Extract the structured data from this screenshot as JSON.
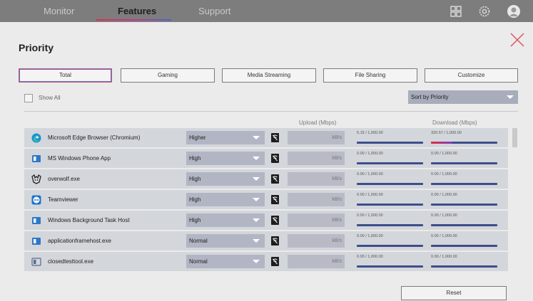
{
  "nav": {
    "items": [
      {
        "label": "Monitor",
        "active": false
      },
      {
        "label": "Features",
        "active": true
      },
      {
        "label": "Support",
        "active": false
      }
    ],
    "icons": [
      "grid-icon",
      "gear-icon",
      "profile-icon"
    ]
  },
  "page": {
    "title": "Priority",
    "tabs": [
      {
        "label": "Total",
        "active": true
      },
      {
        "label": "Gaming",
        "active": false
      },
      {
        "label": "Media Streaming",
        "active": false
      },
      {
        "label": "File Sharing",
        "active": false
      },
      {
        "label": "Customize",
        "active": false
      }
    ],
    "show_all_label": "Show All",
    "show_all_checked": false,
    "sort_selected": "Sort by Priority",
    "upload_header": "Upload (Mbps)",
    "download_header": "Download (Mbps)",
    "reset_label": "Reset"
  },
  "apps": [
    {
      "name": "Microsoft Edge Browser (Chromium)",
      "icon": "edge-icon",
      "priority": "Higher",
      "unit": "kB/s",
      "upload": "5.15 / 1,000.00",
      "download": "320.57 / 1,000.00",
      "upload_fraction": 0.00515,
      "download_fraction": 0.32057
    },
    {
      "name": "MS Windows Phone App",
      "icon": "window-app-icon",
      "priority": "High",
      "unit": "kB/s",
      "upload": "0.00 / 1,000.00",
      "download": "0.00 / 1,000.00",
      "upload_fraction": 0,
      "download_fraction": 0
    },
    {
      "name": "overwolf.exe",
      "icon": "overwolf-icon",
      "priority": "High",
      "unit": "kB/s",
      "upload": "0.00 / 1,000.00",
      "download": "0.00 / 1,000.00",
      "upload_fraction": 0,
      "download_fraction": 0
    },
    {
      "name": "Teamviewer",
      "icon": "teamviewer-icon",
      "priority": "High",
      "unit": "kB/s",
      "upload": "0.00 / 1,000.00",
      "download": "0.00 / 1,000.00",
      "upload_fraction": 0,
      "download_fraction": 0
    },
    {
      "name": "Windows Background Task Host",
      "icon": "window-app-icon",
      "priority": "High",
      "unit": "kB/s",
      "upload": "0.00 / 1,000.00",
      "download": "0.00 / 1,000.00",
      "upload_fraction": 0,
      "download_fraction": 0
    },
    {
      "name": "applicationframehost.exe",
      "icon": "window-app-icon",
      "priority": "Normal",
      "unit": "kB/s",
      "upload": "0.00 / 1,000.00",
      "download": "0.00 / 1,000.00",
      "upload_fraction": 0,
      "download_fraction": 0
    },
    {
      "name": "closedtesttool.exe",
      "icon": "window-app-outline-icon",
      "priority": "Normal",
      "unit": "kB/s",
      "upload": "0.00 / 1,000.00",
      "download": "0.00 / 1,000.00",
      "upload_fraction": 0,
      "download_fraction": 0
    }
  ],
  "colors": {
    "topbar": "#7d7d7d",
    "accent_red": "#d8324a",
    "accent_blue": "#4b63c9",
    "meter": "#3d4e8a"
  }
}
